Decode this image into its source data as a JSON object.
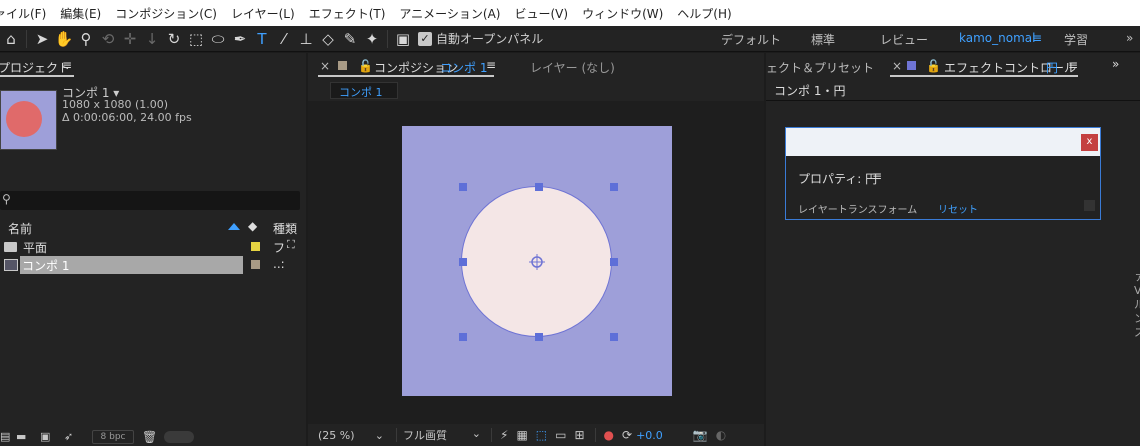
{
  "menu": [
    "ァイル(F)",
    "編集(E)",
    "コンポジション(C)",
    "レイヤー(L)",
    "エフェクト(T)",
    "アニメーション(A)",
    "ビュー(V)",
    "ウィンドウ(W)",
    "ヘルプ(H)"
  ],
  "toolbar": {
    "snap_label": "自動オープンパネル",
    "workspaces": [
      "デフォルト",
      "標準",
      "レビュー",
      "kamo_nomal",
      "学習"
    ],
    "accent": "#3fa0ff"
  },
  "project": {
    "title": "プロジェクト",
    "comp_name": "コンポ 1 ▾",
    "comp_size": "1080 x 1080 (1.00)",
    "comp_duration": "Δ 0:00:06:00, 24.00 fps",
    "search_placeholder": "",
    "col_name": "名前",
    "col_type": "種類",
    "items": [
      {
        "name": "平面",
        "type": "フ",
        "label_color": "#e6d442"
      },
      {
        "name": "コンポ 1",
        "type": "..:",
        "label_color": "#a89a85"
      }
    ],
    "bpc": "8 bpc"
  },
  "comp": {
    "tab_label": "コンポジション",
    "tab_comp": "コンポ 1",
    "layer_tab": "レイヤー (なし)",
    "breadcrumb": "コンポ 1",
    "zoom": "(25 %)",
    "resolution": "フル画質",
    "exposure": "+0.0"
  },
  "effects": {
    "presets_tab": "ェクト＆プリセット",
    "control_tab": "エフェクトコントロール",
    "control_tab_target": "円",
    "layer_path": "コンポ 1・円",
    "property_label": "プロパティ: 円",
    "transform_label": "レイヤートランスフォーム",
    "reset_label": "リセット",
    "close_label": "x"
  }
}
